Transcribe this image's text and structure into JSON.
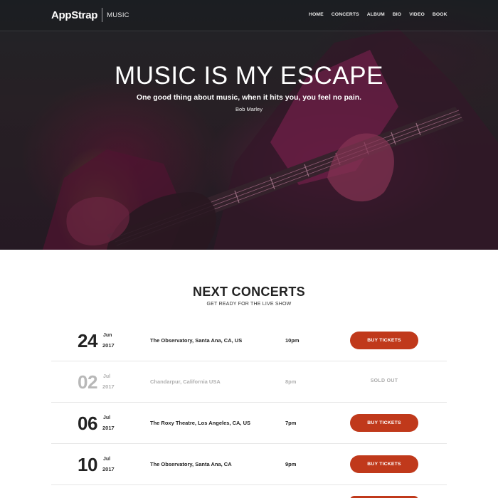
{
  "nav": {
    "logo": "AppStrap",
    "logo_sub": "MUSIC",
    "links": [
      "HOME",
      "CONCERTS",
      "ALBUM",
      "BIO",
      "VIDEO",
      "BOOK"
    ]
  },
  "hero": {
    "title": "MUSIC IS MY ESCAPE",
    "quote": "One good thing about music, when it hits you, you feel no pain.",
    "author": "Bob Marley"
  },
  "concerts": {
    "title": "NEXT CONCERTS",
    "subtitle": "GET READY FOR THE LIVE SHOW",
    "button_label": "BUY TICKETS",
    "rows": [
      {
        "day": "24",
        "month": "Jun",
        "year": "2017",
        "venue": "The Observatory, Santa Ana, CA, US",
        "time": "10pm",
        "status": "BUY TICKETS"
      },
      {
        "day": "02",
        "month": "Jul",
        "year": "2017",
        "venue": "Chandarpur, California USA",
        "time": "8pm",
        "status": "SOLD OUT"
      },
      {
        "day": "06",
        "month": "Jul",
        "year": "2017",
        "venue": "The Roxy Theatre, Los Angeles, CA, US",
        "time": "7pm",
        "status": "BUY TICKETS"
      },
      {
        "day": "10",
        "month": "Jul",
        "year": "2017",
        "venue": "The Observatory, Santa Ana, CA",
        "time": "9pm",
        "status": "BUY TICKETS"
      }
    ]
  },
  "colors": {
    "accent": "#c0391b",
    "muted": "#b0b0b0"
  }
}
